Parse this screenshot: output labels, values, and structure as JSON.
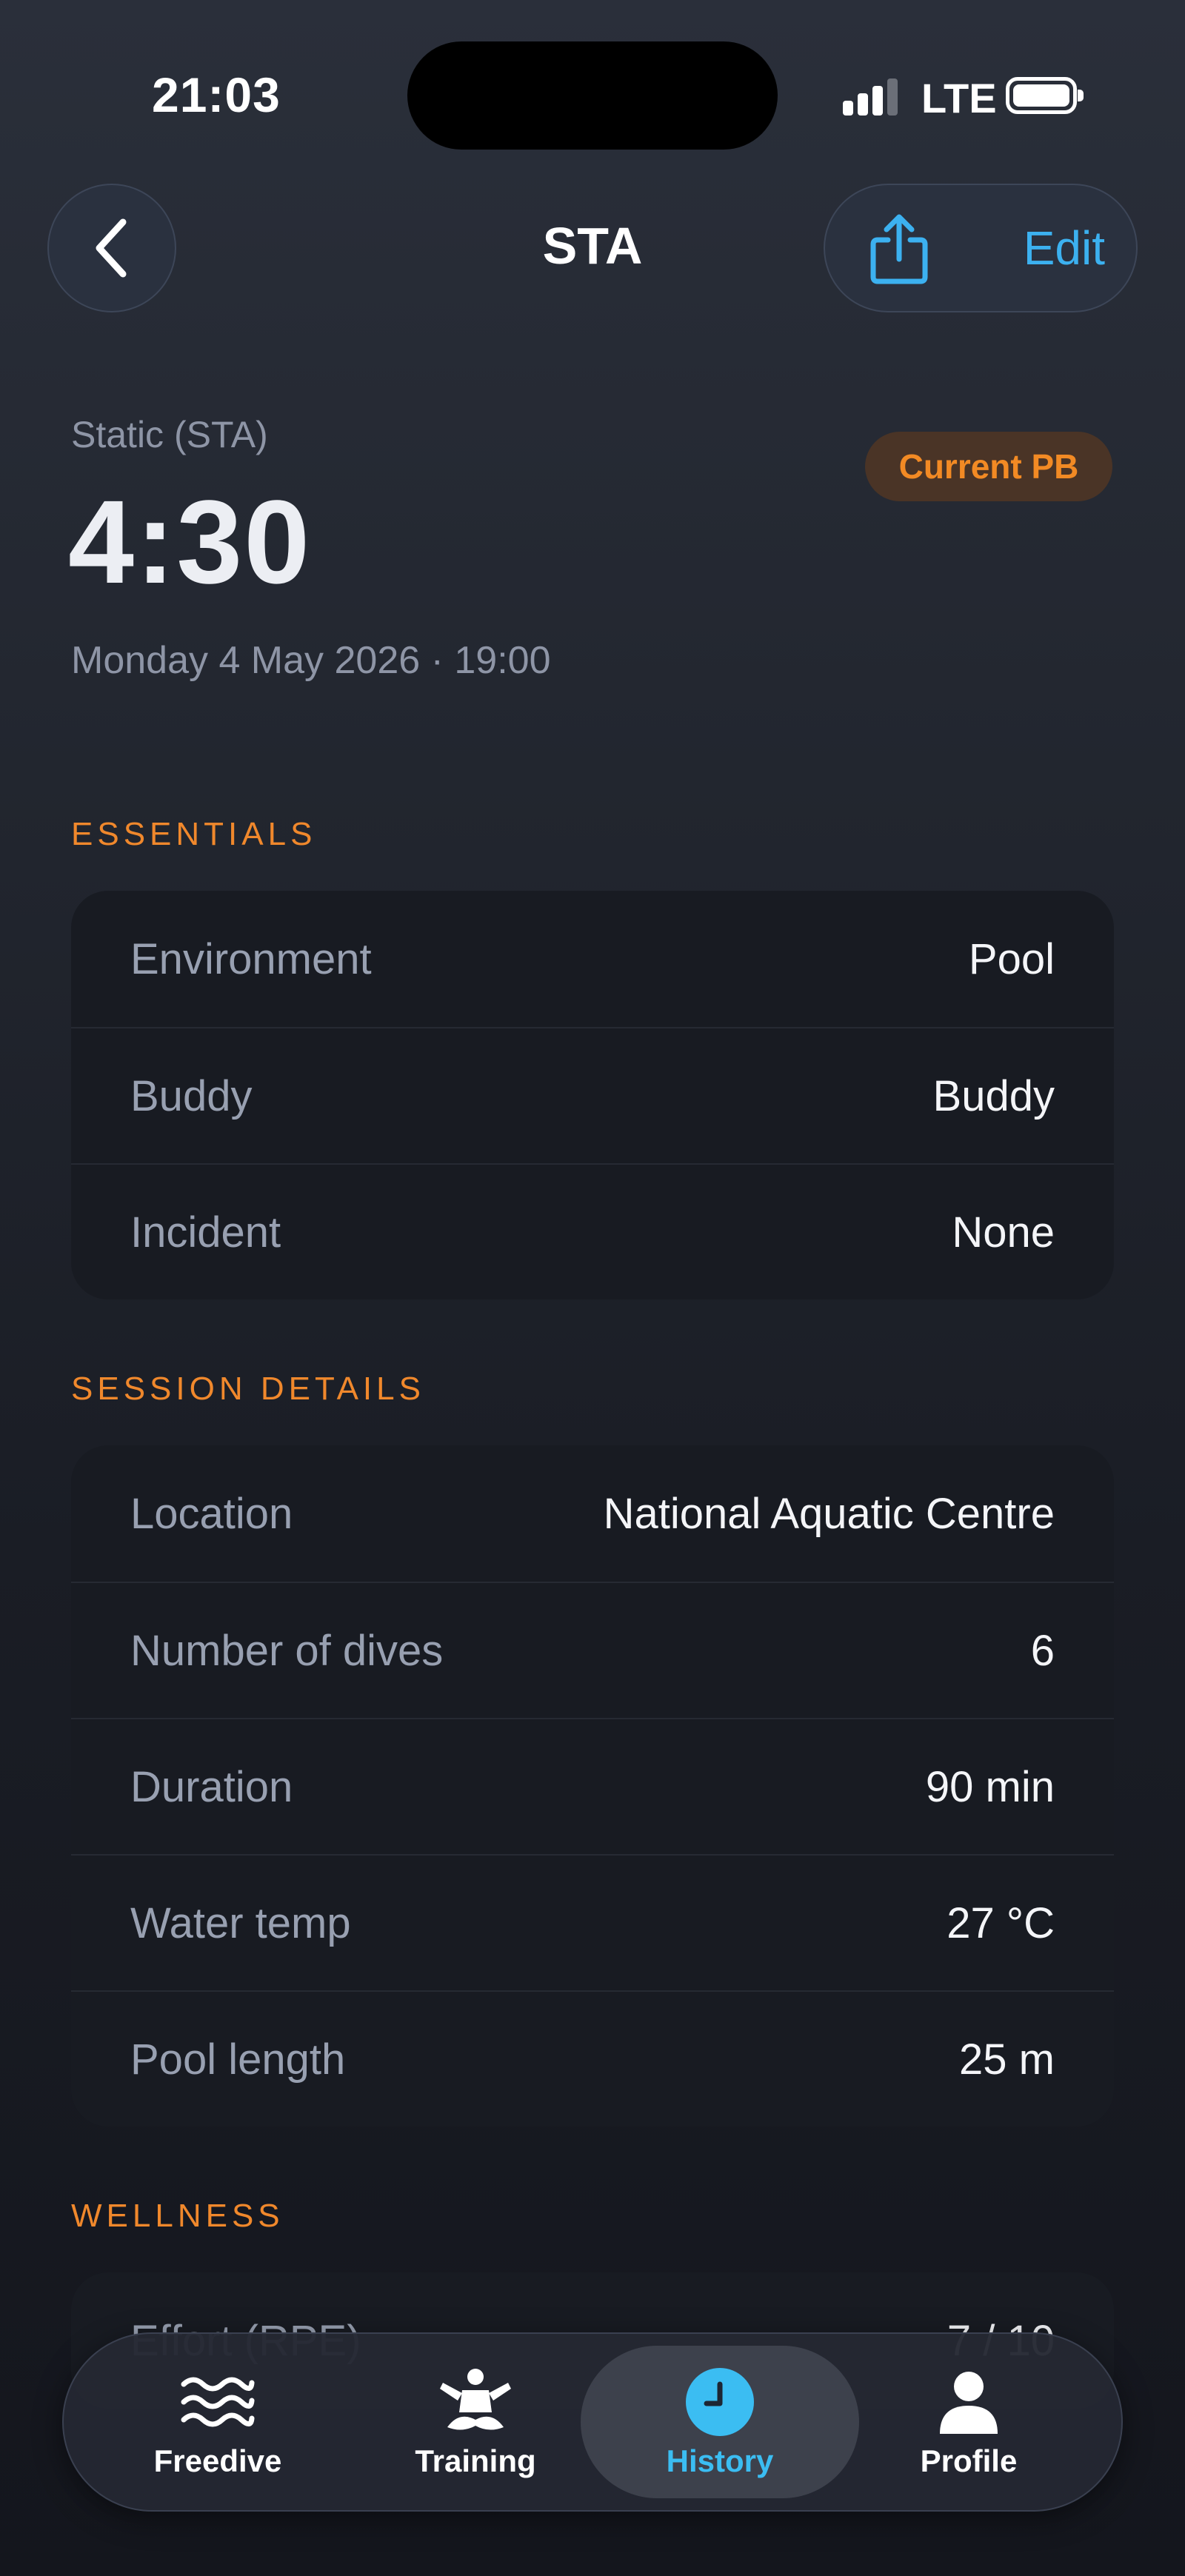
{
  "status_bar": {
    "time": "21:03",
    "network": "LTE"
  },
  "nav": {
    "title": "STA",
    "edit_label": "Edit"
  },
  "header": {
    "discipline": "Static (STA)",
    "badge": "Current PB",
    "result": "4:30",
    "date": "Monday 4 May 2026 · 19:00"
  },
  "essentials": {
    "title": "ESSENTIALS",
    "rows": [
      {
        "label": "Environment",
        "value": "Pool"
      },
      {
        "label": "Buddy",
        "value": "Buddy"
      },
      {
        "label": "Incident",
        "value": "None"
      }
    ]
  },
  "session_details": {
    "title": "SESSION DETAILS",
    "rows": [
      {
        "label": "Location",
        "value": "National Aquatic Centre"
      },
      {
        "label": "Number of dives",
        "value": "6"
      },
      {
        "label": "Duration",
        "value": "90 min"
      },
      {
        "label": "Water temp",
        "value": "27 °C"
      },
      {
        "label": "Pool length",
        "value": "25 m"
      }
    ]
  },
  "wellness": {
    "title": "WELLNESS",
    "rows": [
      {
        "label": "Effort (RPE)",
        "value": "7 / 10"
      }
    ]
  },
  "tab_bar": {
    "tabs": [
      {
        "label": "Freedive",
        "icon": "waves-icon"
      },
      {
        "label": "Training",
        "icon": "meditation-icon"
      },
      {
        "label": "History",
        "icon": "clock-icon",
        "active": true
      },
      {
        "label": "Profile",
        "icon": "person-icon"
      }
    ]
  },
  "colors": {
    "accent": "#3cb1f0",
    "section_header": "#f0882c",
    "badge_text": "#f28a24",
    "badge_bg": "#4a3426"
  }
}
